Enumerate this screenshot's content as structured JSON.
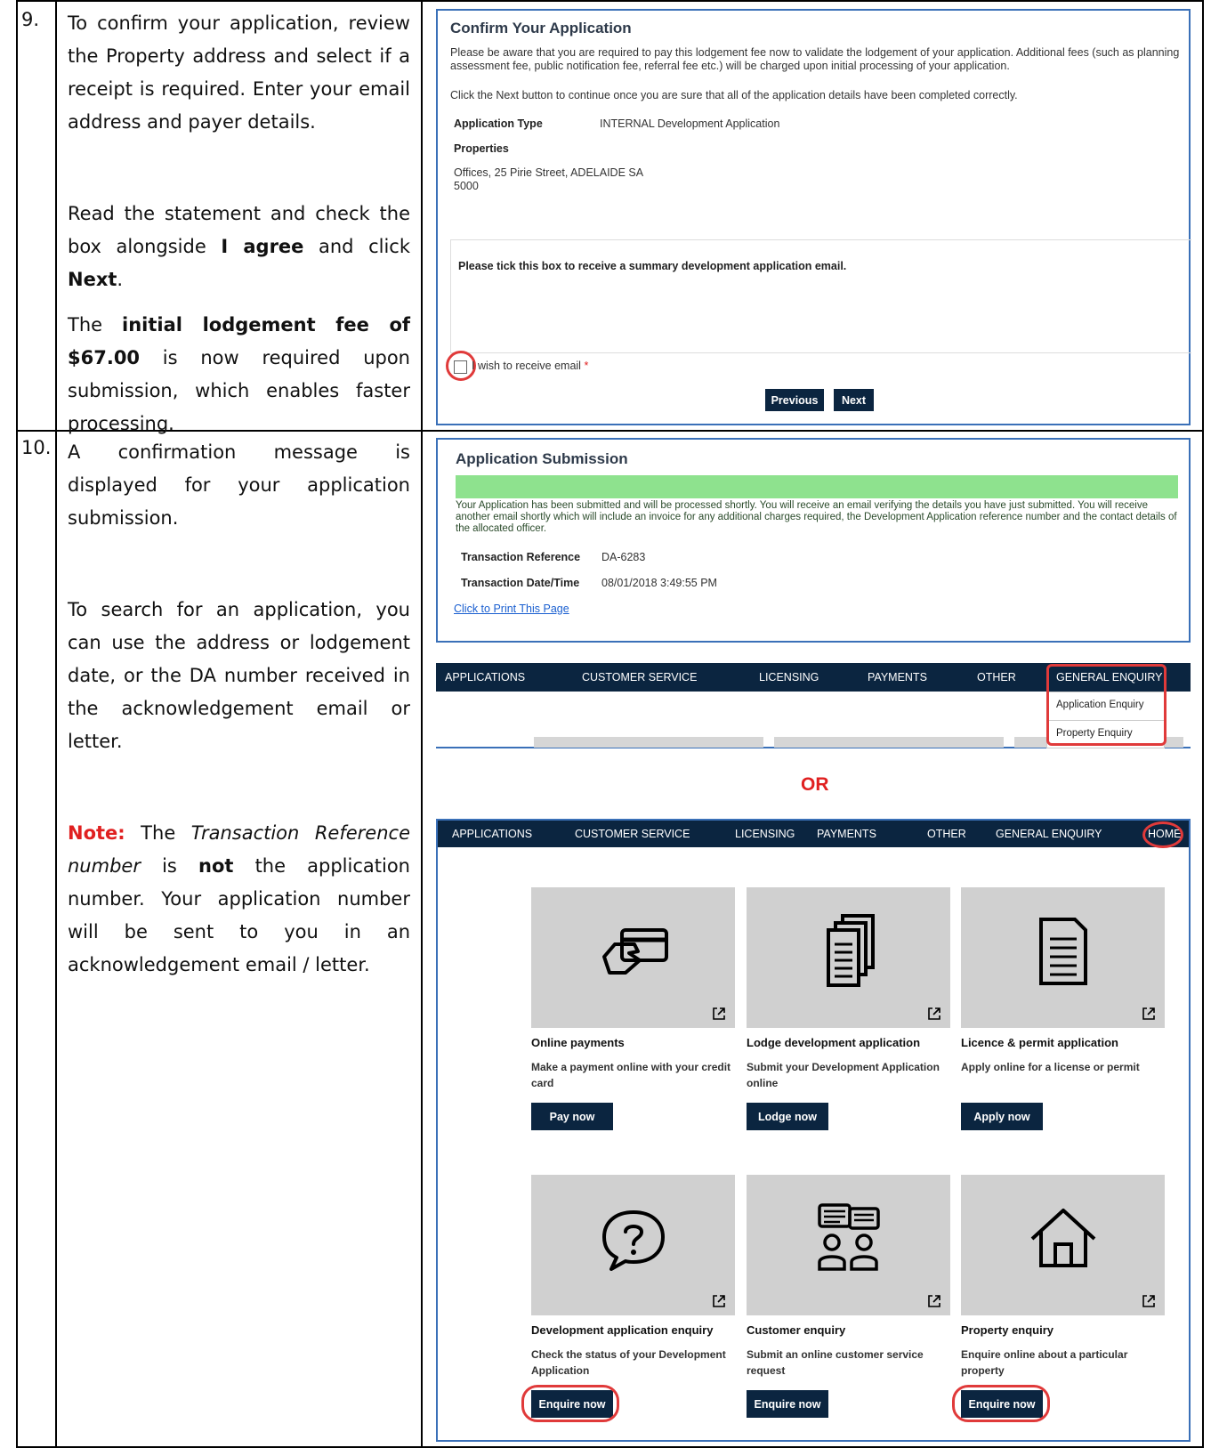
{
  "steps": {
    "step9": {
      "number": "9.",
      "para1": "To confirm your application, review the Property address and select if a receipt is required. Enter your email address and payer details.",
      "para2_pre": "Read the statement and check the box alongside ",
      "para2_bold1": "I agree",
      "para2_mid": " and click ",
      "para2_bold2": "Next",
      "para2_end": ".",
      "para3_pre": "The ",
      "para3_bold": "initial lodgement fee of $67.00",
      "para3_end": " is now required upon submission, which enables faster processing."
    },
    "step10": {
      "number": "10.",
      "para1": "A confirmation message is displayed for your application submission.",
      "para2": "To search for an application, you can use the address or lodgement date, or the DA number received in the acknowledgement email or letter.",
      "note_label": "Note:",
      "note_pre": " The ",
      "note_italic": "Transaction Reference number",
      "note_mid": " is ",
      "note_bold": "not",
      "note_end": " the application number. Your application number will be sent to you in an acknowledgement email / letter."
    }
  },
  "confirm": {
    "title": "Confirm Your Application",
    "notice": "Please be aware that you are required to pay this lodgement fee now to validate the lodgement of your application. Additional fees (such as planning assessment fee, public notification fee, referral fee etc.) will be charged upon initial processing of your application.",
    "instruction": "Click the Next button to continue once you are sure that all of the application details have been completed correctly.",
    "app_type_label": "Application Type",
    "app_type_value": "INTERNAL Development Application",
    "properties_label": "Properties",
    "property_line1": "Offices, 25 Pirie Street, ADELAIDE SA",
    "property_line2": "5000",
    "tick_prompt": "Please tick this box to receive a summary development application email.",
    "checkbox_label": "I wish to receive email",
    "required_mark": "*",
    "previous_label": "Previous",
    "next_label": "Next"
  },
  "submission": {
    "title": "Application Submission",
    "message": "Your Application has been submitted and will be processed shortly. You will receive an email verifying the details you have just submitted. You will receive another email shortly which will include an invoice for any additional charges required, the Development Application reference number and the contact details of the allocated officer.",
    "ref_label": "Transaction Reference",
    "ref_value": "DA-6283",
    "date_label": "Transaction Date/Time",
    "date_value": "08/01/2018 3:49:55 PM",
    "print_link": "Click to Print This Page"
  },
  "nav1": {
    "items": [
      "APPLICATIONS",
      "CUSTOMER SERVICE",
      "LICENSING",
      "PAYMENTS",
      "OTHER",
      "GENERAL ENQUIRY"
    ],
    "dropdown": [
      "Application Enquiry",
      "Property Enquiry"
    ]
  },
  "or_label": "OR",
  "nav2": {
    "items": [
      "APPLICATIONS",
      "CUSTOMER SERVICE",
      "LICENSING",
      "PAYMENTS",
      "OTHER",
      "GENERAL ENQUIRY",
      "HOME"
    ]
  },
  "tiles": [
    {
      "icon": "credit-card-icon",
      "title": "Online payments",
      "desc": "Make a payment online with your credit card",
      "button": "Pay now"
    },
    {
      "icon": "documents-icon",
      "title": "Lodge development application",
      "desc": "Submit your Development Application online",
      "button": "Lodge now"
    },
    {
      "icon": "document-icon",
      "title": "Licence & permit application",
      "desc": "Apply online for a license or permit",
      "button": "Apply now"
    },
    {
      "icon": "question-icon",
      "title": "Development application enquiry",
      "desc": "Check the status of your Development Application",
      "button": "Enquire now"
    },
    {
      "icon": "people-chat-icon",
      "title": "Customer enquiry",
      "desc": "Submit an online customer service request",
      "button": "Enquire now"
    },
    {
      "icon": "house-icon",
      "title": "Property enquiry",
      "desc": "Enquire online about a particular property",
      "button": "Enquire now"
    }
  ],
  "colors": {
    "navy": "#0b2540",
    "highlight": "#e03a3a",
    "success": "#8ee28e",
    "border": "#3a70b8"
  }
}
